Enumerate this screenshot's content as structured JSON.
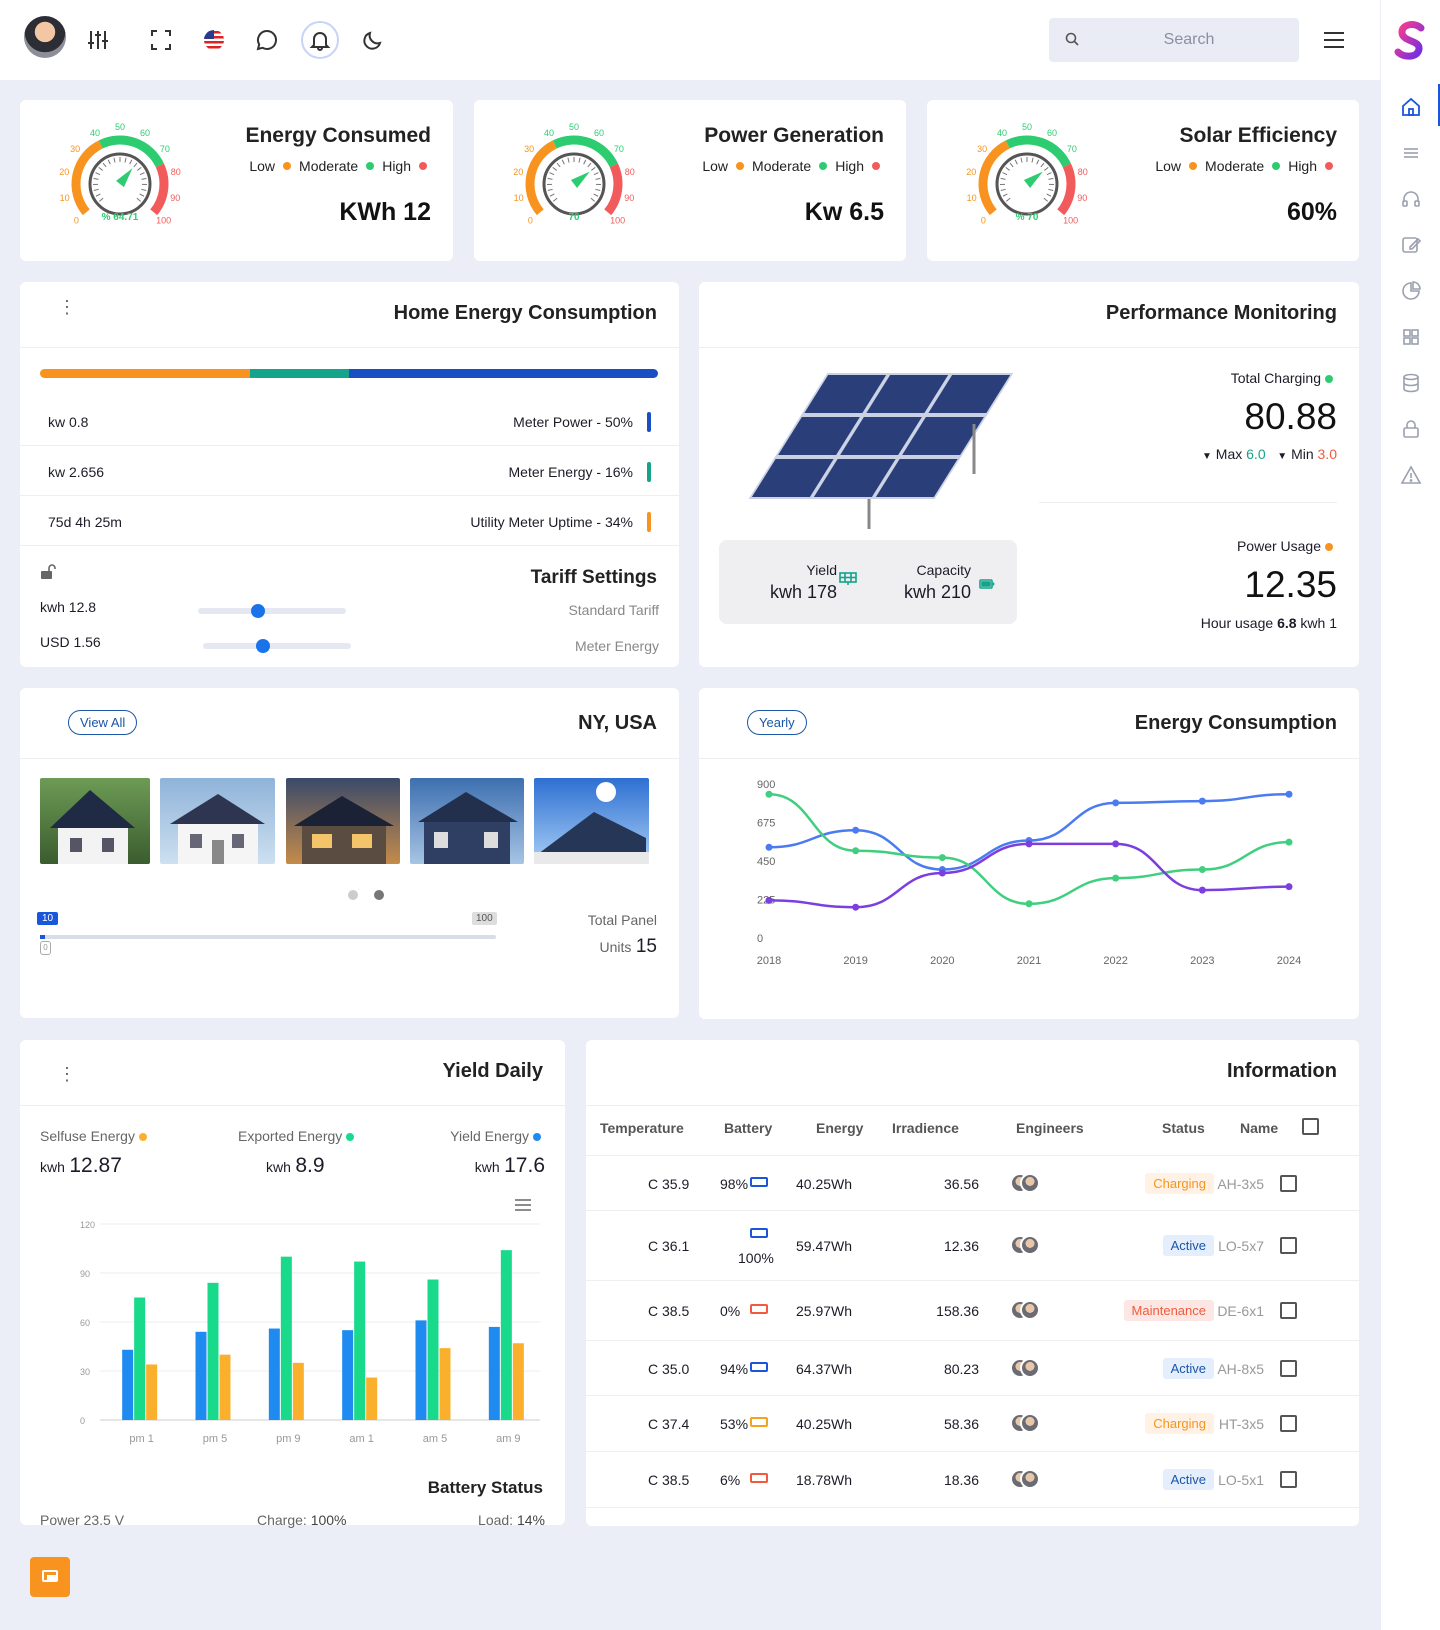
{
  "header": {
    "search_placeholder": "Search"
  },
  "gauges": [
    {
      "title": "Energy Consumed",
      "value": "KWh 12",
      "center_label": "% 64.71",
      "needle": 64.71,
      "ticks": [
        "0",
        "10",
        "20",
        "30",
        "40",
        "50",
        "60",
        "70",
        "80",
        "90",
        "100"
      ]
    },
    {
      "title": "Power Generation",
      "value": "Kw 6.5",
      "center_label": "70",
      "needle": 70,
      "ticks": [
        "0",
        "10",
        "20",
        "30",
        "40",
        "50",
        "60",
        "70",
        "80",
        "90",
        "100"
      ]
    },
    {
      "title": "Solar Efficiency",
      "value": "60%",
      "center_label": "% 70",
      "needle": 70,
      "ticks": [
        "0",
        "10",
        "20",
        "30",
        "40",
        "50",
        "60",
        "70",
        "80",
        "90",
        "100"
      ]
    }
  ],
  "legend": {
    "low": "Low",
    "moderate": "Moderate",
    "high": "High"
  },
  "colors": {
    "low": "#f7931e",
    "moderate": "#2ecc71",
    "high": "#f15b5b",
    "blue": "#1a56db",
    "teal": "#14a38b"
  },
  "home": {
    "title": "Home Energy Consumption",
    "segments": [
      {
        "pct": 34,
        "color": "#f7931e"
      },
      {
        "pct": 16,
        "color": "#14a38b"
      },
      {
        "pct": 50,
        "color": "#1a4fc4"
      }
    ],
    "rows": [
      {
        "left": "kw 0.8",
        "right": "Meter Power - 50%",
        "color": "#1a4fc4"
      },
      {
        "left": "kw 2.656",
        "right": "Meter Energy - 16%",
        "color": "#14a38b"
      },
      {
        "left": "75d 4h 25m",
        "right": "Utility Meter Uptime - 34%",
        "color": "#f7931e"
      }
    ],
    "tariff_title": "Tariff Settings",
    "tariff1_value": "kwh 12.8",
    "tariff1_label": "Standard Tariff",
    "tariff2_value": "USD 1.56",
    "tariff2_label": "Meter Energy"
  },
  "performance": {
    "title": "Performance Monitoring",
    "yield_label": "Yield",
    "yield_value": "kwh 178",
    "capacity_label": "Capacity",
    "capacity_value": "kwh 210",
    "total_charging_label": "Total Charging",
    "total_charging_value": "80.88",
    "max_label": "Max",
    "max_value": "6.0",
    "min_label": "Min",
    "min_value": "3.0",
    "power_usage_label": "Power Usage",
    "power_usage_value": "12.35",
    "hour_usage_prefix": "Hour usage",
    "hour_usage_value": "6.8",
    "hour_usage_suffix": "kwh 1"
  },
  "location": {
    "title": "NY, USA",
    "view_all": "View All",
    "slider_min": "10",
    "slider_max": "100",
    "slider_low_value": "0",
    "total_panel_label": "Total Panel",
    "units_label": "Units",
    "units_value": "15"
  },
  "energy_chart": {
    "title": "Energy Consumption",
    "filter": "Yearly",
    "chart_data": {
      "type": "line",
      "x": [
        "2018",
        "2019",
        "2020",
        "2021",
        "2022",
        "2023",
        "2024"
      ],
      "yticks": [
        "0",
        "225",
        "450",
        "675",
        "900"
      ],
      "ylim": [
        0,
        900
      ],
      "series": [
        {
          "values": [
            530,
            630,
            400,
            570,
            790,
            800,
            840
          ],
          "color": "#4a7bf0"
        },
        {
          "values": [
            840,
            510,
            470,
            200,
            350,
            400,
            560
          ],
          "color": "#3fcf7f"
        },
        {
          "values": [
            220,
            180,
            380,
            550,
            550,
            280,
            300
          ],
          "color": "#7b3fe0"
        }
      ]
    }
  },
  "yield": {
    "title": "Yield Daily",
    "selfuse_label": "Selfuse Energy",
    "selfuse_unit": "kwh",
    "selfuse_value": "12.87",
    "exported_label": "Exported Energy",
    "exported_unit": "kwh",
    "exported_value": "8.9",
    "yield_label": "Yield Energy",
    "yield_unit": "kwh",
    "yield_value": "17.6",
    "battery_title": "Battery Status",
    "power": "Power 23.5 V",
    "charge_label": "Charge:",
    "charge_value": "100%",
    "load_label": "Load:",
    "load_value": "14%",
    "chart_data": {
      "type": "bar",
      "categories": [
        "pm 1",
        "pm 5",
        "pm 9",
        "am 1",
        "am 5",
        "am 9"
      ],
      "yticks": [
        "0",
        "30",
        "60",
        "90",
        "120"
      ],
      "ylim": [
        0,
        120
      ],
      "series": [
        {
          "values": [
            43,
            54,
            56,
            55,
            61,
            57
          ],
          "color": "#1f8bf0"
        },
        {
          "values": [
            75,
            84,
            100,
            97,
            86,
            104
          ],
          "color": "#19d98b"
        },
        {
          "values": [
            34,
            40,
            35,
            26,
            44,
            47
          ],
          "color": "#fbb02d"
        }
      ]
    }
  },
  "information": {
    "title": "Information",
    "headers": [
      "Temperature",
      "Battery",
      "Energy",
      "Irradience",
      "Engineers",
      "Status",
      "Name"
    ],
    "rows": [
      {
        "temp": "C 35.9",
        "battery": "98%",
        "bcolor": "#1a56db",
        "energy": "40.25Wh",
        "irr": "36.56",
        "status": "Charging",
        "name": "AH-3x5"
      },
      {
        "temp": "C 36.1",
        "battery": "100%",
        "bcolor": "#1a56db",
        "energy": "59.47Wh",
        "irr": "12.36",
        "status": "Active",
        "name": "LO-5x7"
      },
      {
        "temp": "C 38.5",
        "battery": "0%",
        "bcolor": "#f15b3b",
        "energy": "25.97Wh",
        "irr": "158.36",
        "status": "Maintenance",
        "name": "DE-6x1"
      },
      {
        "temp": "C 35.0",
        "battery": "94%",
        "bcolor": "#1a56db",
        "energy": "64.37Wh",
        "irr": "80.23",
        "status": "Active",
        "name": "AH-8x5"
      },
      {
        "temp": "C 37.4",
        "battery": "53%",
        "bcolor": "#f7a21e",
        "energy": "40.25Wh",
        "irr": "58.36",
        "status": "Charging",
        "name": "HT-3x5"
      },
      {
        "temp": "C 38.5",
        "battery": "6%",
        "bcolor": "#f15b3b",
        "energy": "18.78Wh",
        "irr": "18.36",
        "status": "Active",
        "name": "LO-5x1"
      }
    ]
  }
}
